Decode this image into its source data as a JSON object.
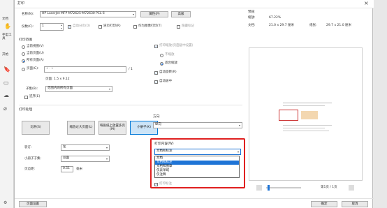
{
  "dialog": {
    "title": "打印",
    "close": "×"
  },
  "side": {
    "items": [
      "文档",
      "手型工具",
      "开始"
    ]
  },
  "printer": {
    "name_label": "名称(N):",
    "name_value": "HP LaserJet MFP M72625-M72630 PCL 6",
    "properties_button": "属性(P)",
    "advanced_button": "高级",
    "copies_label": "份数(C):",
    "copies_value": "1",
    "collate_label": "自动分页(O)",
    "reverse_label": "逆页打印(R)",
    "print_as_image_label": "作为图像打印(T)",
    "annotations_label": "隐藏标记"
  },
  "range": {
    "title": "打印范围",
    "current_view": "当前视图(V)",
    "current_page": "当前页面(U)",
    "all_pages": "所有页面(A)",
    "pages_label": "页面(G):",
    "pages_placeholder": "1 - 1",
    "pages_total": "/ 1",
    "page_size": "页面: 1.5 x 9.12",
    "subset_label": "子集(B):",
    "subset_value": "范围内的所有页面",
    "reverse_label": "逆序(E)"
  },
  "scale": {
    "title": "打印缩放(页面居中设置)",
    "none": "不缩放",
    "fit": "适合缩放",
    "auto_rotate": "自动旋转(R)",
    "auto_center": "自动居中"
  },
  "handling": {
    "title": "打印处理",
    "buttons": [
      "比例(S)",
      "缩放过大页面(L)",
      "每张纸上放置多页(M)",
      "小册子(K)"
    ]
  },
  "orientation": {
    "title": "方向",
    "value": "纵向"
  },
  "options": {
    "layout_label": "装订:",
    "layout_value": "左",
    "binding_label": "小册子子集:",
    "binding_value": "双面",
    "margin_label": "页边距:",
    "margin_value": "0.51",
    "margin_unit": "毫米"
  },
  "print_content": {
    "title": "打印内容(W)",
    "value": "文档和标注",
    "options": [
      "文档",
      "文档和标注",
      "文档和图章",
      "仅表单域",
      "仅注释"
    ],
    "extra_label": "打印标注"
  },
  "preview": {
    "title": "预览",
    "scale_label": "缩放:",
    "scale_value": "67.22%",
    "doc_label": "文档:",
    "doc_value": "21.0 x 29.7 厘米",
    "paper_label": "纸张:",
    "paper_value": "29.7 x 21.0 厘米",
    "page_counter": "第1页 / 1页"
  },
  "footer": {
    "page_setup": "页面设置",
    "ok": "确定",
    "cancel": "取消"
  }
}
